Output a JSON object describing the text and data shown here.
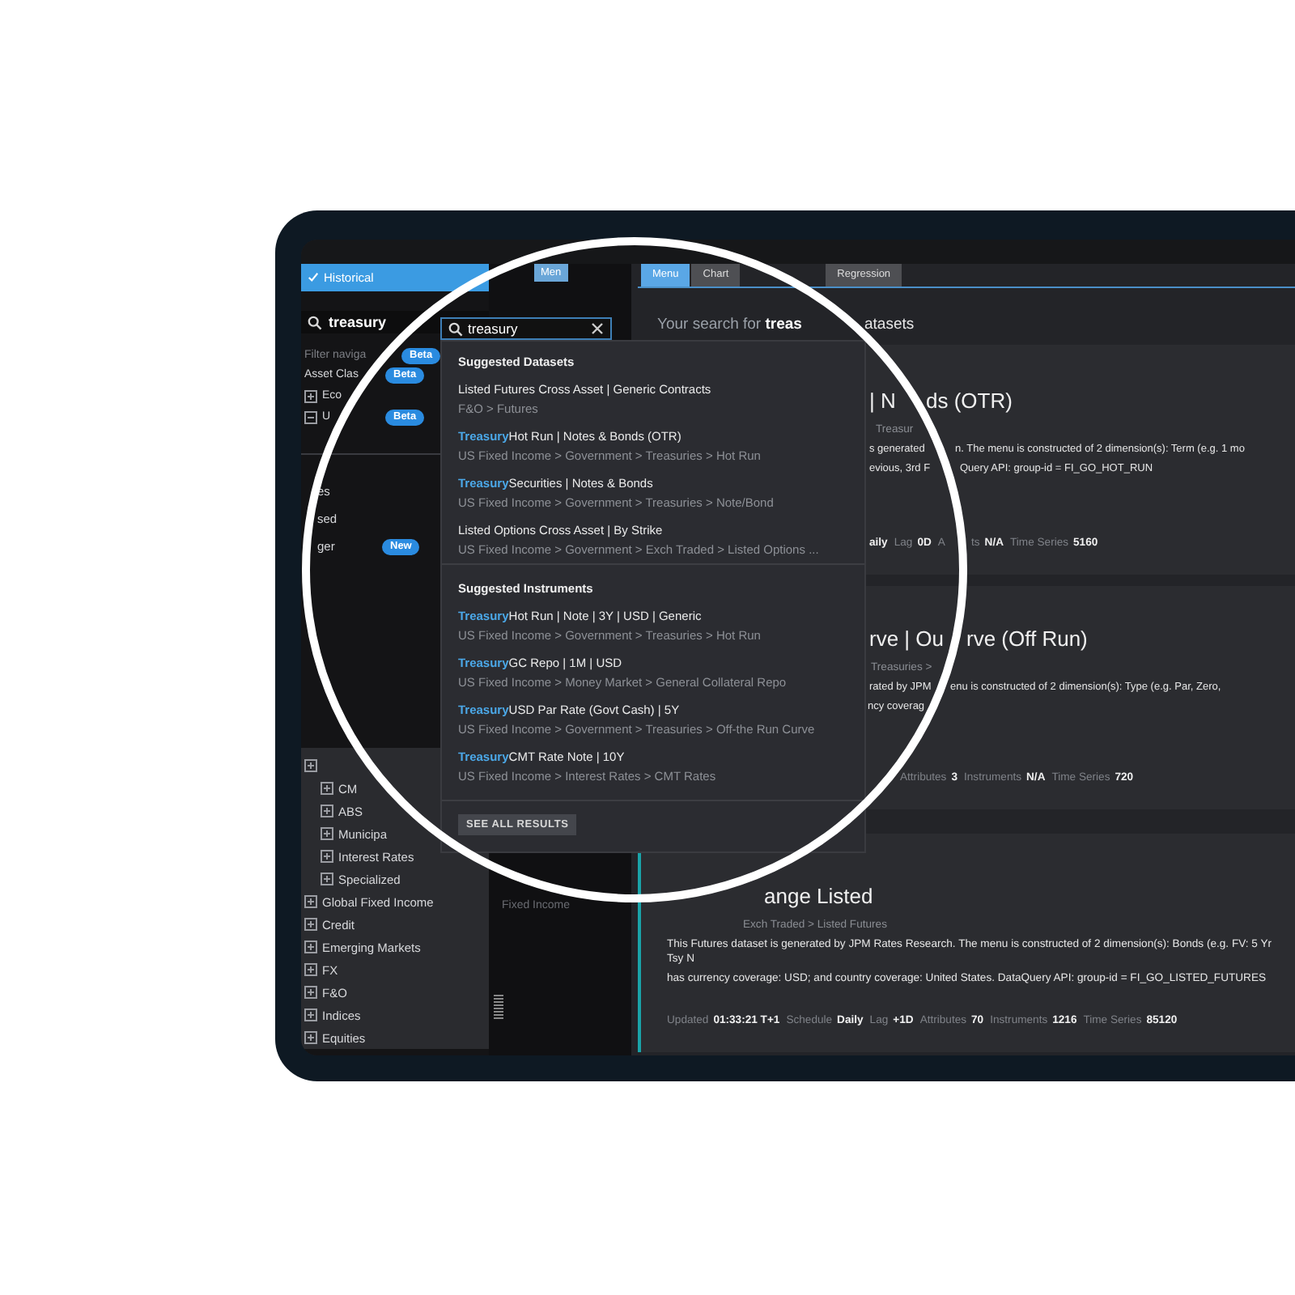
{
  "left_panel": {
    "mode_tab": {
      "label": "Historical",
      "selected": true
    },
    "search": {
      "value": "treasury"
    },
    "filter": {
      "placeholder": "Filter naviga",
      "badge": "Beta"
    },
    "items": [
      {
        "label": "Asset Clas",
        "badge": "Beta"
      },
      {
        "label": "Eco",
        "expanded": false
      },
      {
        "label": "U",
        "expanded": true,
        "badge": "Beta"
      }
    ],
    "links": [
      {
        "label": "es"
      },
      {
        "label": "sed"
      },
      {
        "label": "ger",
        "badge": "New"
      }
    ],
    "tree": [
      {
        "expanded": false,
        "children": [
          {
            "label": "CM",
            "expanded": false
          },
          {
            "label": "ABS",
            "expanded": false
          },
          {
            "label": "Municipa",
            "expanded": false
          },
          {
            "label": "Interest Rates",
            "expanded": false
          },
          {
            "label": "Specialized",
            "expanded": false
          }
        ]
      },
      {
        "label": "Global Fixed Income",
        "expanded": false
      },
      {
        "label": "Credit",
        "expanded": false
      },
      {
        "label": "Emerging Markets",
        "expanded": false
      },
      {
        "label": "FX",
        "expanded": false
      },
      {
        "label": "F&O",
        "expanded": false
      },
      {
        "label": "Indices",
        "expanded": false
      },
      {
        "label": "Equities",
        "expanded": false
      }
    ]
  },
  "middle_panel": {
    "tab": {
      "label": "Men",
      "selected": true
    },
    "ghost_text": "Fixed Income"
  },
  "search_dropdown": {
    "value": "treasury",
    "sections": [
      {
        "title": "Suggested Datasets",
        "results": [
          {
            "title": "Listed Futures Cross Asset | Generic Contracts",
            "path": "F&O > Futures"
          },
          {
            "match": "Treasury",
            "title": "Hot Run | Notes & Bonds (OTR)",
            "path": "US Fixed Income > Government > Treasuries > Hot Run"
          },
          {
            "match": "Treasury",
            "title": "Securities | Notes & Bonds",
            "path": "US Fixed Income > Government > Treasuries > Note/Bond"
          },
          {
            "title": "Listed Options Cross Asset | By Strike",
            "path": "US Fixed Income > Government > Exch Traded > Listed Options ..."
          }
        ]
      },
      {
        "title": "Suggested Instruments",
        "results": [
          {
            "match": "Treasury",
            "title": "Hot Run | Note | 3Y | USD | Generic",
            "path": "US Fixed Income > Government > Treasuries > Hot Run"
          },
          {
            "match": "Treasury",
            "title": "GC Repo | 1M | USD",
            "path": "US Fixed Income > Money Market > General Collateral Repo"
          },
          {
            "match": "Treasury",
            "title": "USD Par Rate (Govt Cash) | 5Y",
            "path": "US Fixed Income > Government > Treasuries > Off-the Run Curve"
          },
          {
            "match": "Treasury",
            "title": "CMT Rate Note | 10Y",
            "path": "US Fixed Income > Interest Rates > CMT Rates"
          }
        ]
      }
    ],
    "button": "SEE ALL RESULTS"
  },
  "content": {
    "tabs": [
      {
        "label": "Menu",
        "selected": true
      },
      {
        "label": "Chart",
        "selected": false
      },
      {
        "label": "Regression",
        "selected": false
      }
    ],
    "heading": "Your search for **treas**",
    "heading_tail": "atasets",
    "cards": [
      {
        "title_parts": [
          "| N",
          "ds (OTR)"
        ],
        "path": "Treasur",
        "description": [
          [
            "s generated",
            "n. The menu is constructed of 2 dimension(s): Term (e.g. 1 mo"
          ],
          [
            "evious, 3rd F",
            "Query API: group-id = FI_GO_HOT_RUN"
          ]
        ],
        "meta": [
          {
            "value": "aily"
          },
          {
            "label": "Lag",
            "value": "0D"
          },
          {
            "label": "A"
          },
          {
            "label": "ts",
            "value": "N/A"
          },
          {
            "label": "Time Series",
            "value": "5160"
          }
        ]
      },
      {
        "title_parts": [
          "rve | Ou",
          "rve (Off Run)"
        ],
        "path": "Treasuries >",
        "description": [
          [
            "rated by JPM",
            "enu is constructed of 2 dimension(s): Type (e.g. Par, Zero,"
          ],
          [
            "ncy coverag"
          ]
        ],
        "meta": [
          {
            "label": "Attributes",
            "value": "3"
          },
          {
            "label": "Instruments",
            "value": "N/A"
          },
          {
            "label": "Time Series",
            "value": "720"
          }
        ]
      },
      {
        "title_parts": [
          "ange Listed"
        ],
        "path": "Exch Traded > Listed Futures",
        "description": [
          [
            "This Futures dataset is generated by JPM Rates Research. The menu is constructed of 2 dimension(s): Bonds (e.g. FV: 5 Yr Tsy N"
          ],
          [
            "has currency coverage: USD; and country coverage: United States. DataQuery API: group-id = FI_GO_LISTED_FUTURES"
          ]
        ],
        "meta": [
          {
            "label": "Updated",
            "value": "01:33:21 T+1"
          },
          {
            "label": "Schedule",
            "value": "Daily"
          },
          {
            "label": "Lag",
            "value": "+1D"
          },
          {
            "label": "Attributes",
            "value": "70"
          },
          {
            "label": "Instruments",
            "value": "1216"
          },
          {
            "label": "Time Series",
            "value": "85120"
          }
        ]
      }
    ]
  }
}
